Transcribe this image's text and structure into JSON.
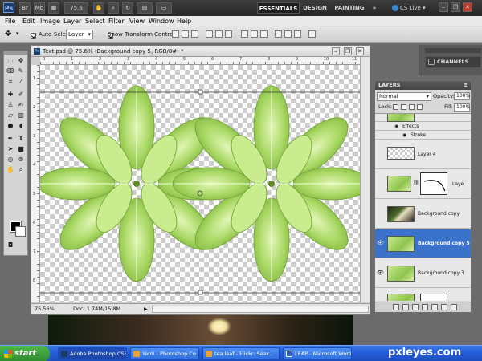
{
  "app": {
    "logo": "Ps",
    "zoom": "75.6",
    "workspaces": [
      "ESSENTIALS",
      "DESIGN",
      "PAINTING",
      "»"
    ],
    "cs_live": "CS Live"
  },
  "menu": [
    "File",
    "Edit",
    "Image",
    "Layer",
    "Select",
    "Filter",
    "View",
    "Window",
    "Help"
  ],
  "options": {
    "auto_select_label": "Auto-Select:",
    "auto_select_value": "Layer",
    "show_transform_label": "Show Transform Controls"
  },
  "document": {
    "title": "Text.psd @ 75.6% (Background copy 5, RGB/8#) *",
    "zoom_status": "75.56%",
    "doc_status": "Doc: 1.74M/15.8M",
    "ruler_top": [
      "0",
      "1",
      "2",
      "3",
      "4",
      "5",
      "6",
      "7",
      "8",
      "9",
      "10",
      "11"
    ],
    "ruler_left": [
      "1",
      "2",
      "3",
      "4",
      "5",
      "6",
      "7",
      "8"
    ]
  },
  "dock": {
    "channels": "CHANNELS"
  },
  "layers_panel": {
    "tab": "LAYERS",
    "blend_mode": "Normal",
    "opacity_label": "Opacity:",
    "opacity_value": "100%",
    "lock_label": "Lock:",
    "fill_label": "Fill:",
    "fill_value": "100%",
    "effects_label": "Effects",
    "stroke_label": "Stroke",
    "layers": [
      {
        "name": "Layer 4",
        "visible": false,
        "selected": false
      },
      {
        "name": "Laye...",
        "visible": false,
        "selected": false
      },
      {
        "name": "Background copy",
        "visible": false,
        "selected": false
      },
      {
        "name": "Background copy 5",
        "visible": true,
        "selected": true
      },
      {
        "name": "Background copy 3",
        "visible": true,
        "selected": false
      }
    ]
  },
  "taskbar": {
    "start": "start",
    "tasks": [
      "Adobe Photoshop CS5",
      "Yenti - Photoshop Co...",
      "tea leaf - Flickr: Sear...",
      "LEAP - Microsoft Word"
    ]
  },
  "watermark": "pxleyes.com",
  "colors": {
    "selection": "#3a73c9",
    "leaf_light": "#c8e890",
    "leaf_mid": "#8ec44d",
    "taskbar": "#245edb",
    "start": "#2e8b2e"
  }
}
